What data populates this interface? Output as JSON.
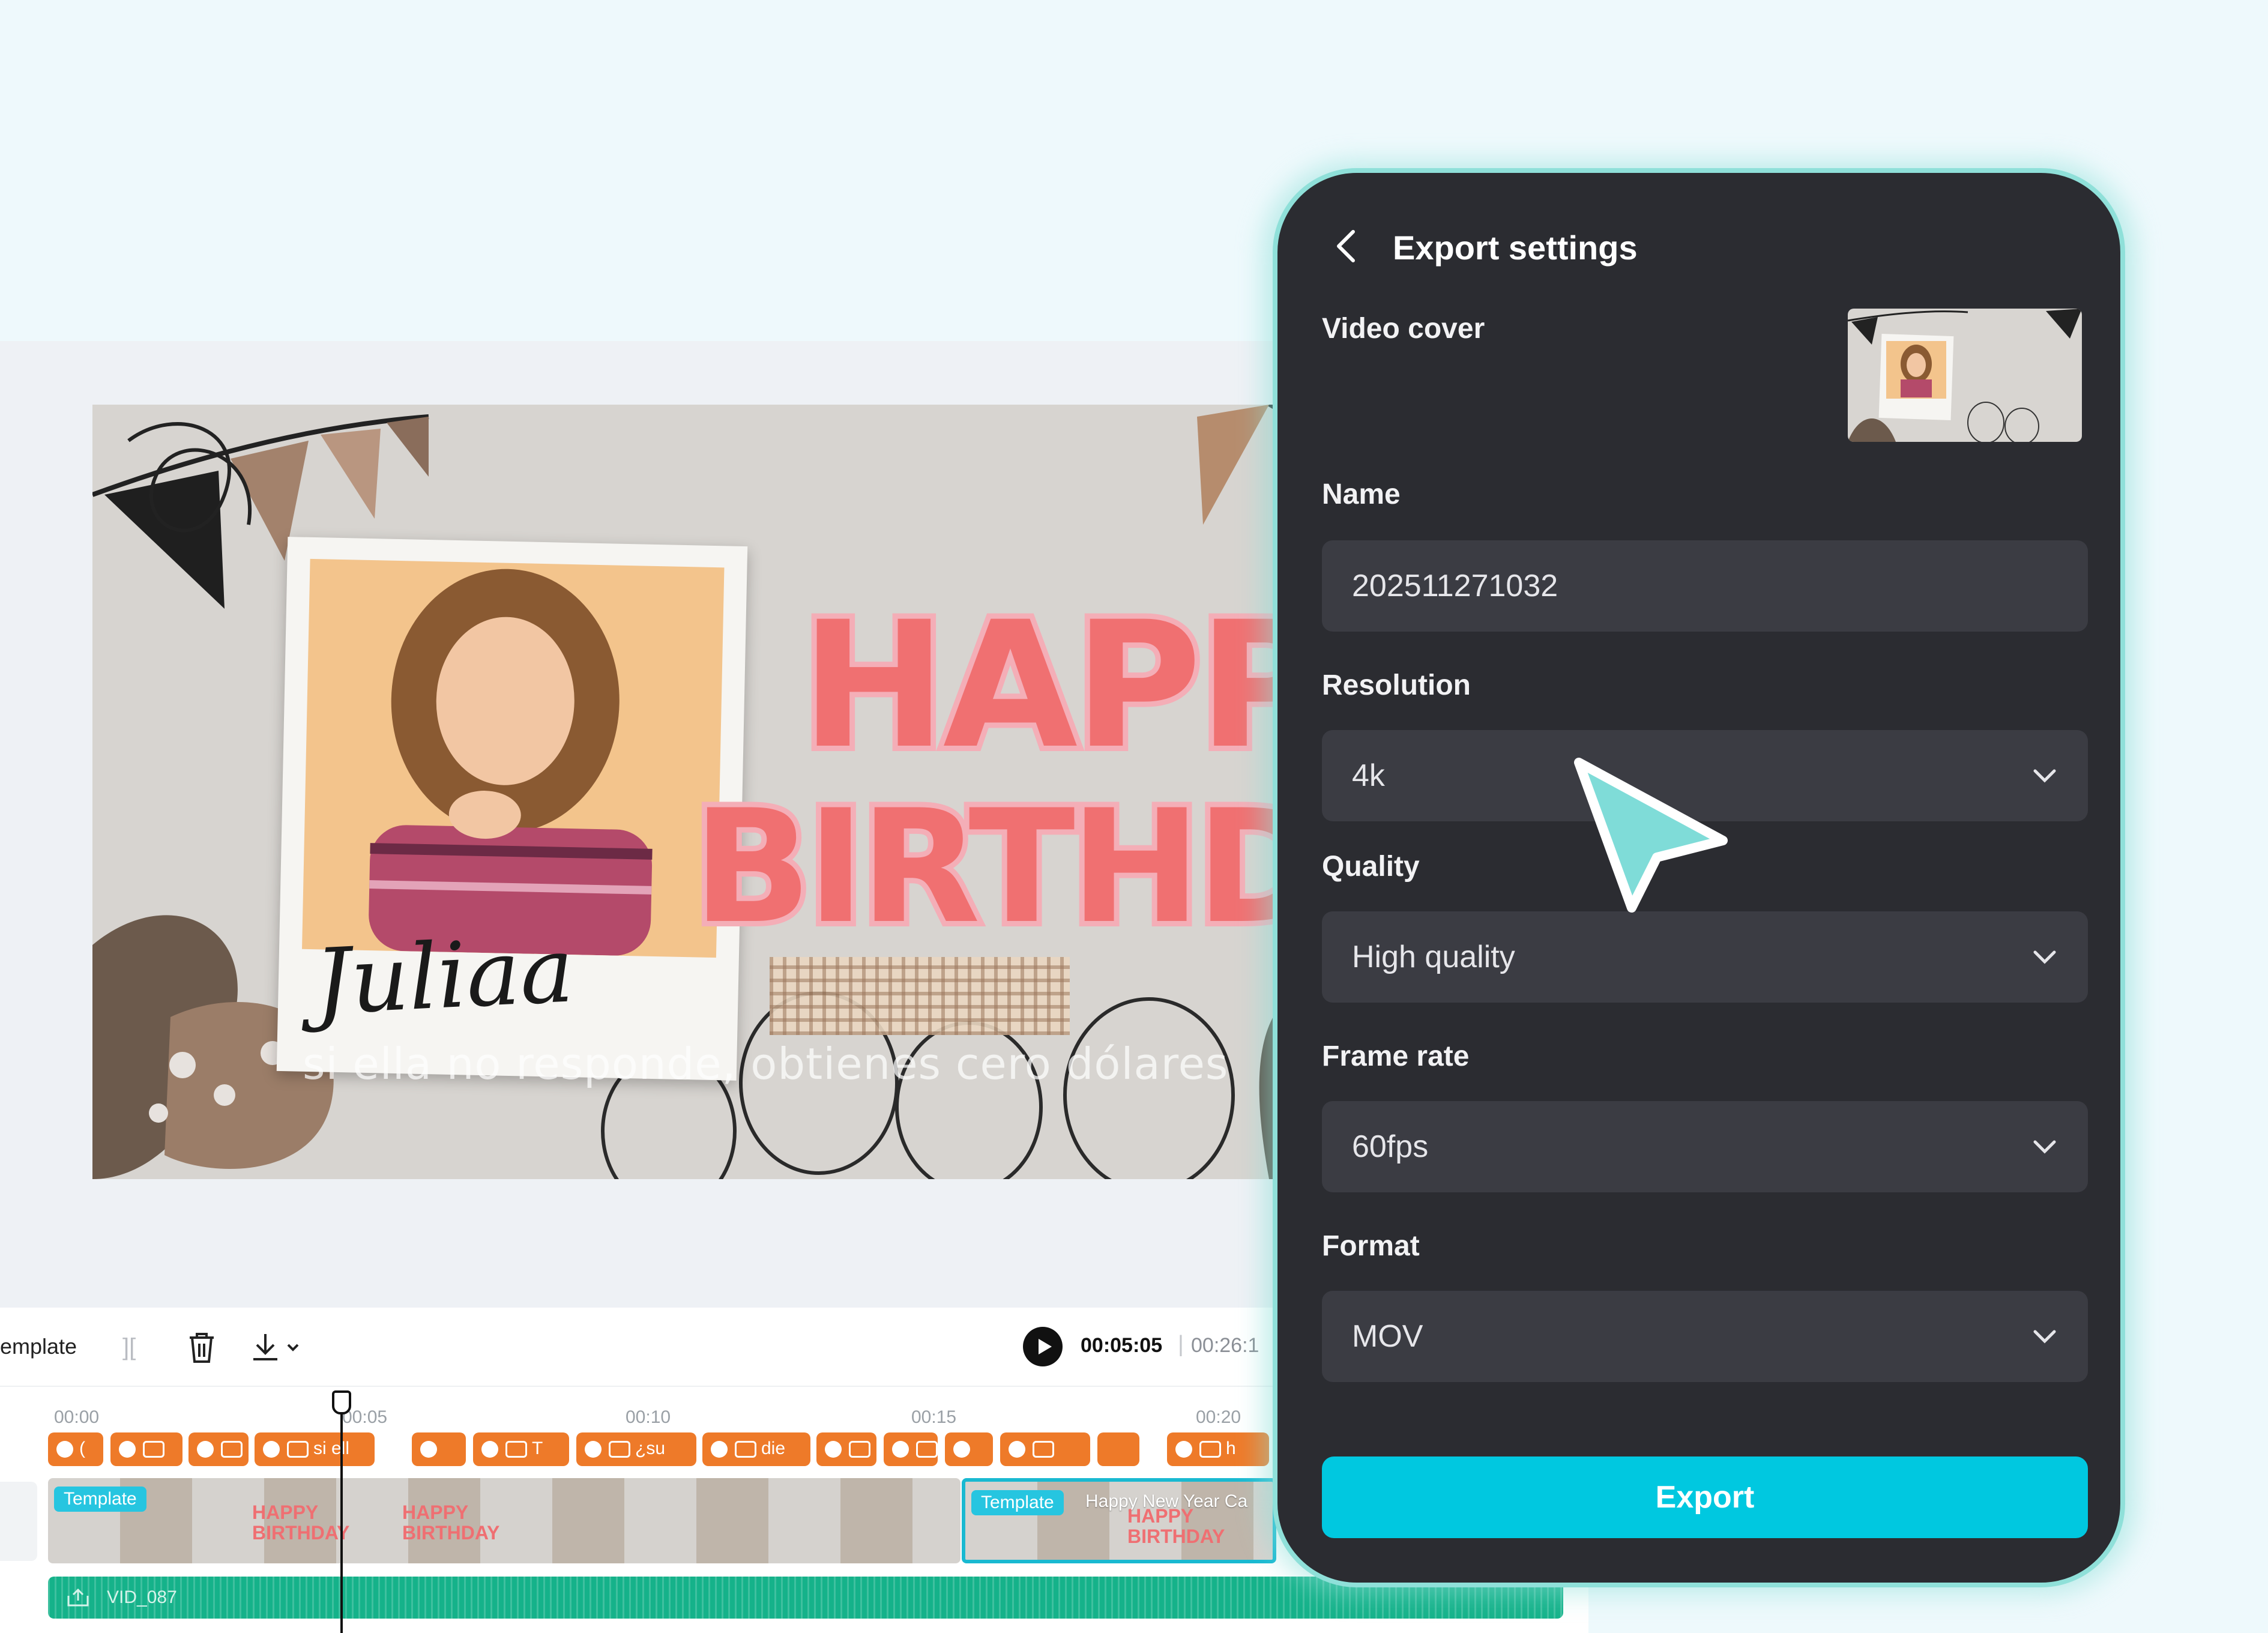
{
  "canvas": {
    "name_text": "Juliaa",
    "happy_text": "HAPPY",
    "birthday_text": "BIRTHDA",
    "subtitle_text": "si ella no responde, obtienes cero dólares"
  },
  "timeline": {
    "track_label": "emplate",
    "current_time": "00:05:05",
    "separator": "|",
    "total_time": "00:26:1",
    "ruler_ticks": [
      "00:00",
      "00:05",
      "00:10",
      "00:15",
      "00:20"
    ],
    "caption_clips": [
      {
        "text": "("
      },
      {
        "text": ""
      },
      {
        "text": ""
      },
      {
        "text": "si ell"
      },
      {
        "text": ""
      },
      {
        "text": "T"
      },
      {
        "text": "¿su"
      },
      {
        "text": "die"
      },
      {
        "text": ""
      },
      {
        "text": ""
      },
      {
        "text": ""
      },
      {
        "text": ""
      },
      {
        "text": ""
      },
      {
        "text": "h"
      }
    ],
    "video_clips": [
      {
        "tag": "Template",
        "name": ""
      },
      {
        "tag": "Template",
        "name": "Happy New Year Ca"
      }
    ],
    "thumb_text_happy": "HAPPY",
    "thumb_text_birthday": "BIRTHDAY",
    "audio_label": "VID_087"
  },
  "export_panel": {
    "title": "Export settings",
    "video_cover_label": "Video cover",
    "name_label": "Name",
    "name_value": "202511271032",
    "resolution_label": "Resolution",
    "resolution_value": "4k",
    "quality_label": "Quality",
    "quality_value": "High quality",
    "frame_rate_label": "Frame rate",
    "frame_rate_value": "60fps",
    "format_label": "Format",
    "format_value": "MOV",
    "export_label": "Export"
  },
  "colors": {
    "panel_bg": "#2b2c31",
    "panel_border": "#8fe0d9",
    "field_bg": "#3b3c43",
    "export_button": "#00c8e0",
    "caption_clip": "#ee7a29",
    "audio_track": "#15b28a",
    "cursor": "#7fdcd8"
  },
  "icons": {
    "back": "chevron-left-icon",
    "dropdown": "chevron-down-icon",
    "trash": "trash-icon",
    "download": "download-icon",
    "play": "play-icon",
    "cursor": "pointer-cursor-icon"
  }
}
